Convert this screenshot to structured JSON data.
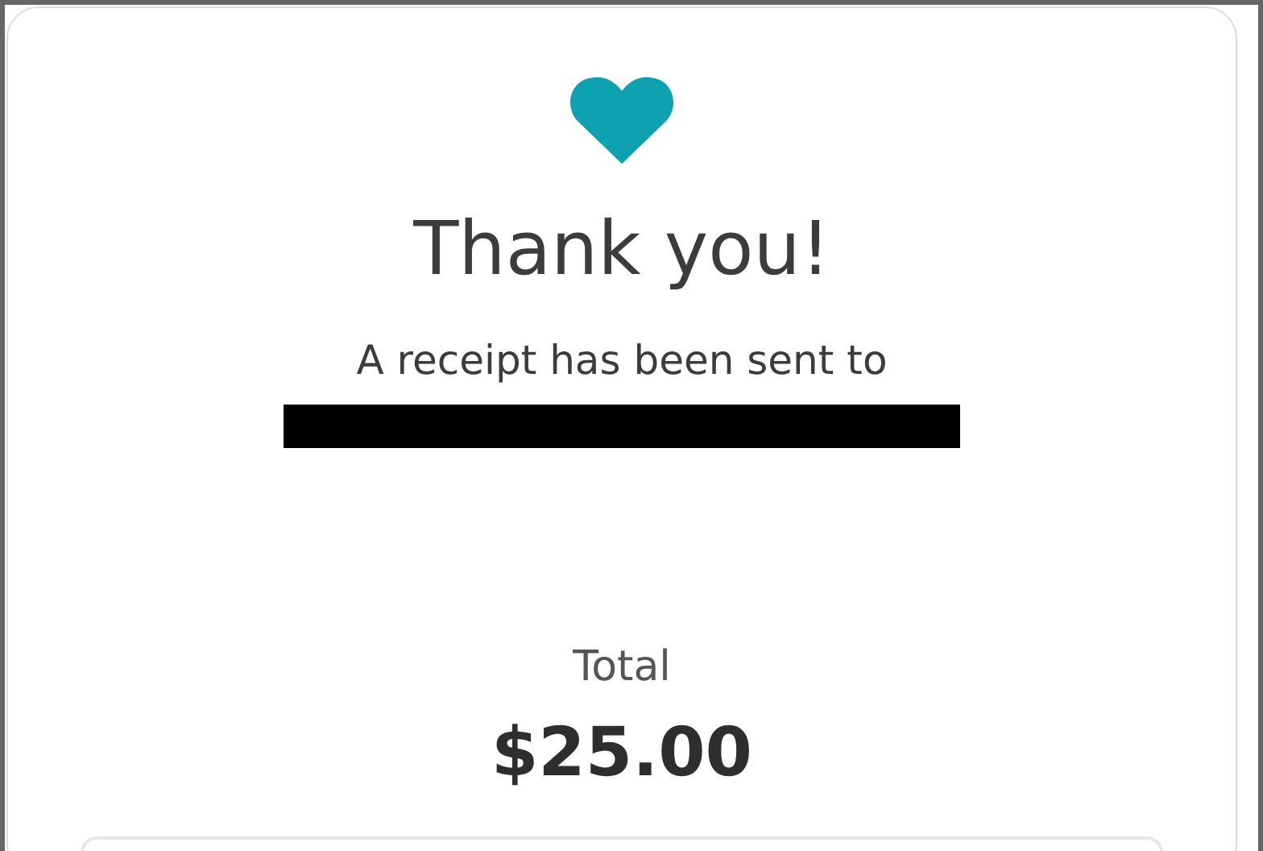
{
  "confirmation": {
    "title": "Thank you!",
    "message": "A receipt has been sent to",
    "email_redacted": true
  },
  "total": {
    "label": "Total",
    "amount": "$25.00"
  }
}
